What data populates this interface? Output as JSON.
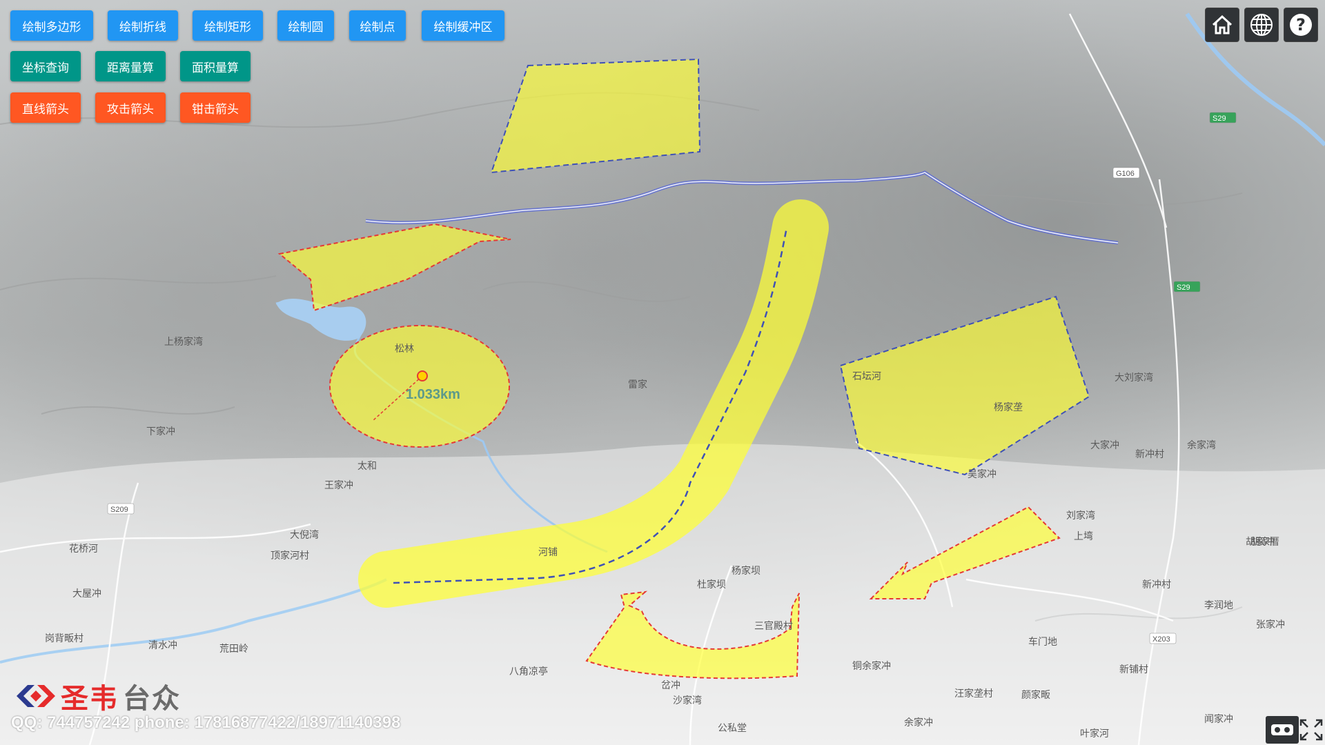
{
  "toolbar": {
    "draw": [
      {
        "label": "绘制多边形"
      },
      {
        "label": "绘制折线"
      },
      {
        "label": "绘制矩形"
      },
      {
        "label": "绘制圆"
      },
      {
        "label": "绘制点"
      },
      {
        "label": "绘制缓冲区"
      }
    ],
    "measure": [
      {
        "label": "坐标查询"
      },
      {
        "label": "距离量算"
      },
      {
        "label": "面积量算"
      }
    ],
    "arrows": [
      {
        "label": "直线箭头"
      },
      {
        "label": "攻击箭头"
      },
      {
        "label": "钳击箭头"
      }
    ]
  },
  "top_right_tools": [
    {
      "icon": "home-icon"
    },
    {
      "icon": "globe-icon"
    },
    {
      "icon": "help-icon"
    }
  ],
  "map": {
    "circle_radius_label": "1.033km",
    "place_labels": [
      "王家冲",
      "大倪湾",
      "顶家河村",
      "花桥河",
      "大屋冲",
      "岗背畈村",
      "清水冲",
      "荒田岭",
      "八角凉亭",
      "岔冲",
      "沙家湾",
      "公私堂",
      "余家冲",
      "汪家垄村",
      "颜家畈",
      "叶家河",
      "闻家冲",
      "车门地",
      "新铺村",
      "新冲村",
      "李润地",
      "张家冲",
      "胡家冲",
      "杨家坝",
      "杜家坝",
      "三官殿村",
      "铜余家冲",
      "上塆",
      "刘家湾",
      "胡家厝",
      "新冲村",
      "石坛河",
      "吴家冲",
      "杨家垄",
      "大家冲",
      "大刘家湾",
      "余家湾",
      "上杨家湾",
      "下家冲",
      "太和",
      "松林",
      "雷家",
      "河铺"
    ],
    "road_labels": [
      "S29",
      "S29",
      "S209",
      "X203",
      "G106"
    ]
  },
  "logo": {
    "brand_red": "圣韦",
    "brand_gray": "台众"
  },
  "contact": "QQ: 744757242     phone: 17816877422/18971140398",
  "bottom_right_tools": [
    {
      "icon": "vr-glasses-icon"
    },
    {
      "icon": "fullscreen-icon"
    }
  ],
  "colors": {
    "blue_button": "#2196f3",
    "teal_button": "#009688",
    "orange_button": "#ff5722",
    "overlay_fill": "#ffff33",
    "outline_red": "#e53935",
    "outline_blue": "#3f51b5"
  }
}
